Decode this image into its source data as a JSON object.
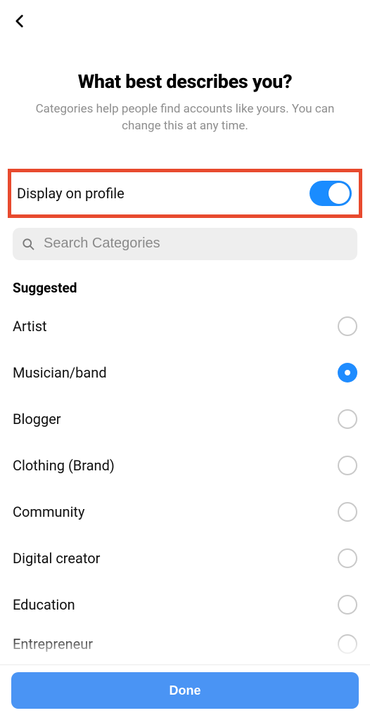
{
  "header": {
    "title": "What best describes you?",
    "subtitle": "Categories help people find accounts like yours. You can change this at any time."
  },
  "toggle": {
    "label": "Display on profile",
    "on": true
  },
  "search": {
    "placeholder": "Search Categories",
    "value": ""
  },
  "section_label": "Suggested",
  "categories": [
    {
      "label": "Artist",
      "selected": false
    },
    {
      "label": "Musician/band",
      "selected": true
    },
    {
      "label": "Blogger",
      "selected": false
    },
    {
      "label": "Clothing (Brand)",
      "selected": false
    },
    {
      "label": "Community",
      "selected": false
    },
    {
      "label": "Digital creator",
      "selected": false
    },
    {
      "label": "Education",
      "selected": false
    },
    {
      "label": "Entrepreneur",
      "selected": false
    }
  ],
  "footer": {
    "done_label": "Done"
  },
  "colors": {
    "accent": "#1f8cff",
    "highlight_border": "#e84a2e",
    "done_bg": "#4a94f4",
    "placeholder": "#8a8a8a",
    "subtle": "#8e8e8e"
  }
}
